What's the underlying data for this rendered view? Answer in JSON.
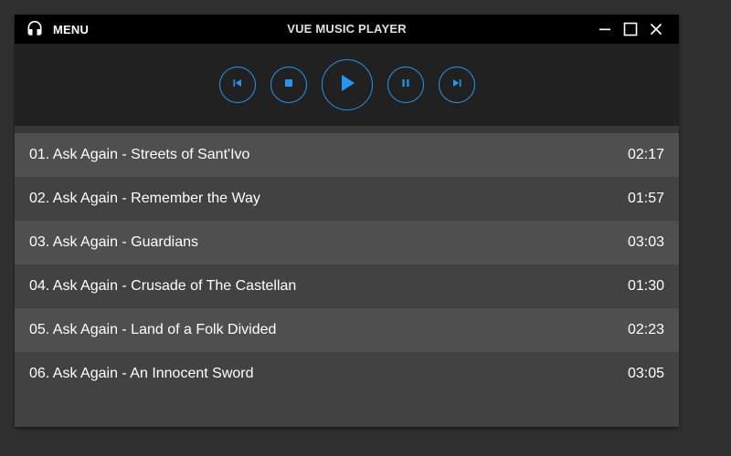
{
  "titlebar": {
    "menu_label": "MENU",
    "menu_icon": "headphones-icon",
    "title": "VUE MUSIC PLAYER",
    "window_controls": [
      "minimize-icon",
      "maximize-icon",
      "close-icon"
    ]
  },
  "controls": {
    "buttons": [
      "skip-previous-icon",
      "stop-icon",
      "play-icon",
      "pause-icon",
      "skip-next-icon"
    ],
    "accent_color": "#2196f3"
  },
  "playlist": {
    "tracks": [
      {
        "title": "01. Ask Again - Streets of Sant'Ivo",
        "duration": "02:17"
      },
      {
        "title": "02. Ask Again - Remember the Way",
        "duration": "01:57"
      },
      {
        "title": "03. Ask Again - Guardians",
        "duration": "03:03"
      },
      {
        "title": "04. Ask Again - Crusade of The Castellan",
        "duration": "01:30"
      },
      {
        "title": "05. Ask Again - Land of a Folk Divided",
        "duration": "02:23"
      },
      {
        "title": "06. Ask Again - An Innocent Sword",
        "duration": "03:05"
      }
    ]
  },
  "colors": {
    "page_background": "#303030",
    "titlebar_background": "#000000",
    "controls_background": "#212121",
    "row_light": "#4f4f4f",
    "row_dark": "#424242"
  }
}
